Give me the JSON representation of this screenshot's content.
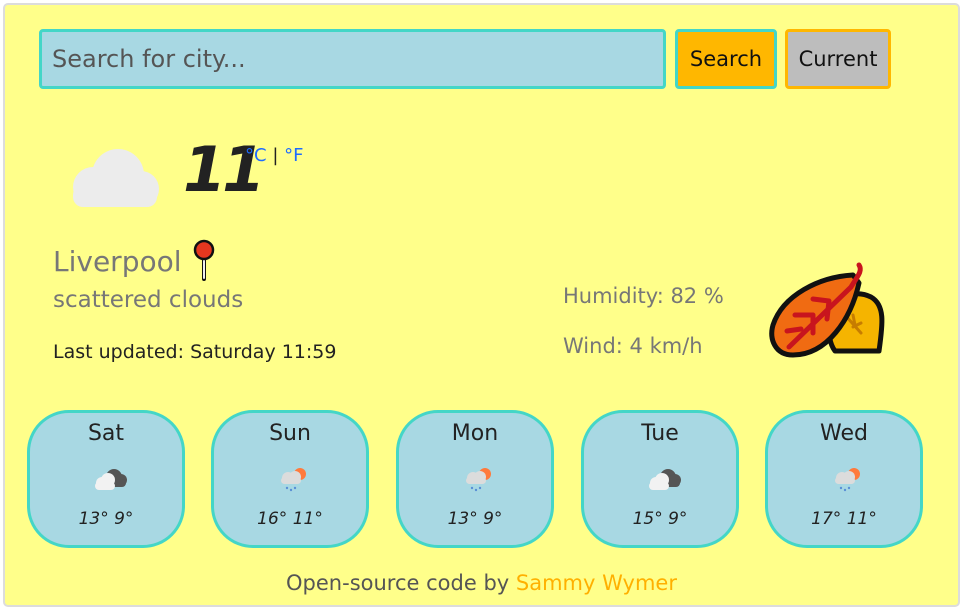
{
  "search": {
    "placeholder": "Search for city...",
    "search_label": "Search",
    "current_label": "Current"
  },
  "weather": {
    "temperature": "11",
    "unit_c": "°C",
    "unit_separator": "|",
    "unit_f": "°F",
    "city": "Liverpool",
    "description": "scattered clouds",
    "last_updated": "Last updated: Saturday 11:59",
    "humidity": "Humidity: 82 %",
    "wind": "Wind: 4 km/h",
    "icon": "cloud-icon"
  },
  "forecast": [
    {
      "day": "Sat",
      "temps": "13° 9°",
      "icon": "broken-clouds-icon"
    },
    {
      "day": "Sun",
      "temps": "16° 11°",
      "icon": "rain-sun-icon"
    },
    {
      "day": "Mon",
      "temps": "13° 9°",
      "icon": "rain-sun-icon"
    },
    {
      "day": "Tue",
      "temps": "15° 9°",
      "icon": "broken-clouds-icon"
    },
    {
      "day": "Wed",
      "temps": "17° 11°",
      "icon": "rain-sun-icon"
    }
  ],
  "footer": {
    "text": "Open-source code",
    "by": "by",
    "author": "Sammy Wymer"
  },
  "colors": {
    "background": "#ffff8a",
    "card": "#a8d8e3",
    "border": "#44d6c7",
    "accent": "#ffb700",
    "link": "#1e6cff"
  }
}
